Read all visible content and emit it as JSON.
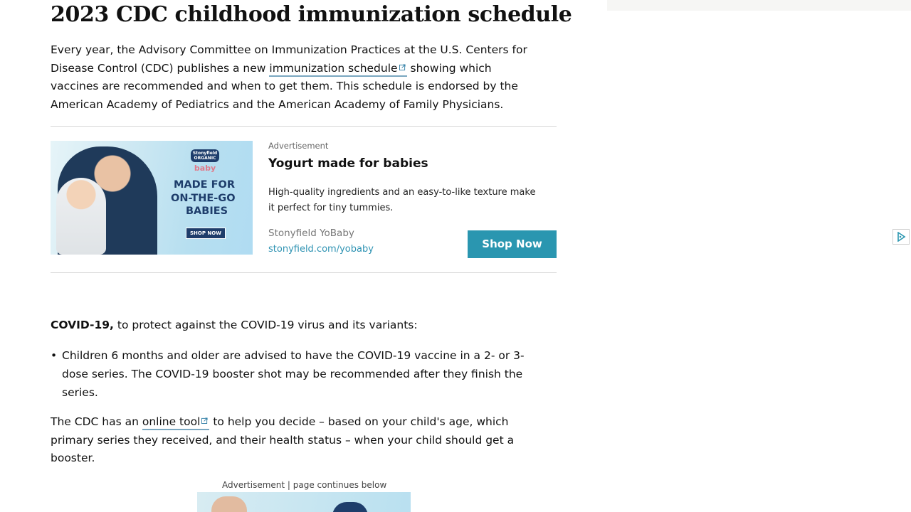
{
  "article": {
    "title": "2023 CDC childhood immunization schedule",
    "intro": {
      "line1": "Every year, the Advisory Committee on Immunization Practices at the U.S. Centers for",
      "line2_before": "Disease Control (CDC) publishes a new ",
      "line2_link": "immunization schedule",
      "line2_after": " showing which",
      "line3": "vaccines are recommended and when to get them. This schedule is endorsed by the",
      "line4": "American Academy of Pediatrics and the American Academy of Family Physicians."
    },
    "covid": {
      "heading_bold": "COVID-19,",
      "heading_rest": " to protect against the COVID-19 virus and its variants:",
      "bullet_line1": "Children 6 months and older are advised to have the COVID-19 vaccine in a 2- or 3-",
      "bullet_line2": "dose series. The COVID-19 booster shot may be recommended after they finish the",
      "bullet_line3": "series.",
      "tool_before": "The CDC has an ",
      "tool_link": "online tool",
      "tool_after": " to help you decide – based on your child's age, which",
      "tool_line2": "primary series they received, and their health status – when your child should get a",
      "tool_line3": "booster."
    }
  },
  "ad": {
    "label": "Advertisement",
    "title": "Yogurt made for babies",
    "desc_line1": "High-quality ingredients and an easy-to-like texture make",
    "desc_line2": "it perfect for tiny tummies.",
    "brand": "Stonyfield YoBaby",
    "url": "stonyfield.com/yobaby",
    "cta": "Shop Now",
    "image": {
      "brand_top": "Stonyfield ORGANIC",
      "brand_sub": "baby",
      "line1": "MADE FOR",
      "line2": "ON-THE-GO",
      "line3": "BABIES",
      "shop": "SHOP NOW"
    }
  },
  "ad2": {
    "label": "Advertisement | page continues below"
  },
  "colors": {
    "accent": "#2a96b0",
    "link_underline": "#7aa7c0",
    "ad_navy": "#1e3d6b"
  },
  "icons": {
    "external": "external-link-icon",
    "adchoices": "adchoices-icon"
  }
}
